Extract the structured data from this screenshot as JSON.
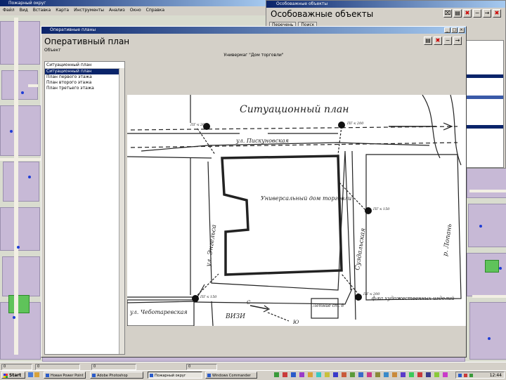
{
  "back_window": {
    "title": "Пожарный округ",
    "menu": [
      "Файл",
      "Вид",
      "Вставка",
      "Карта",
      "Инструменты",
      "Анализ",
      "Окно",
      "Справка"
    ]
  },
  "objects_window": {
    "heading": "Особоважные объекты",
    "tabs": [
      "Перечень",
      "Поиск"
    ],
    "controls": [
      "⌧",
      "▤",
      "✖",
      "−",
      "→",
      "✖"
    ]
  },
  "plan_window": {
    "titlebar": "Оперативные планы",
    "heading": "Оперативный план",
    "sublabel": "Объект",
    "object_name": "Универмаг \"Дом торговли\"",
    "list_header": "Ситуационный план",
    "list_items": [
      "Ситуационный план",
      "План первого этажа",
      "План второго этажа",
      "План третьего этажа"
    ],
    "selected_index": 0,
    "controls": [
      "▤",
      "✖",
      "−",
      "→"
    ],
    "title_controls": [
      "_",
      "□",
      "×"
    ]
  },
  "plan_drawing": {
    "title": "Ситуационный план",
    "street_top": "ул. Пискуновская",
    "street_left": "ул. Энгельса",
    "street_right": "Суздальская",
    "street_bottom_left": "ул. Чеботаревская",
    "river": "р. Лопань",
    "building": "Универсальный дом торговли",
    "bottom_mid": "ВИЗИ",
    "bottom_box": "Летние ст. 8",
    "bottom_right": "ф-ка художественных изделий",
    "hydrants": [
      "ПГ-к 200",
      "ПГ-к 200",
      "ПГ-к 150",
      "ПГ-к 150",
      "ПГ-к 200"
    ],
    "arrow_label_c": "С",
    "arrow_label_u": "Ю"
  },
  "status_strip": [
    "0",
    "0",
    "0",
    "0"
  ],
  "taskbar": {
    "start": "Start",
    "tasks": [
      "Новая Power Point",
      "Adobe Photoshop",
      "Пожарный округ",
      "Windows Commander"
    ],
    "active_index": 2,
    "clock": "12:44"
  }
}
